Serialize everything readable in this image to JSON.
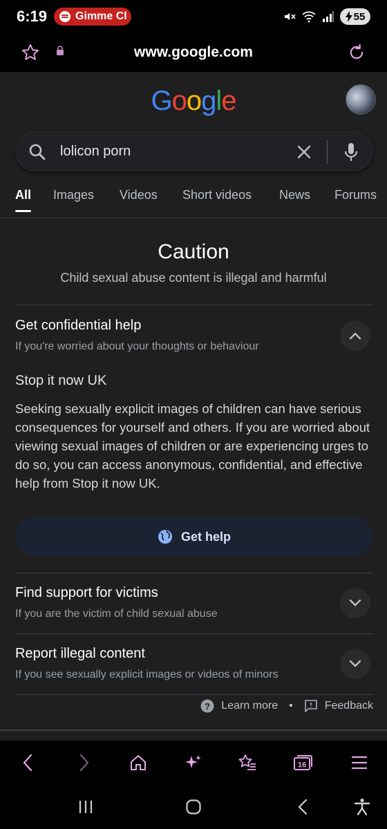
{
  "status": {
    "time": "6:19",
    "media_label": "Gimme Cl",
    "battery": "55",
    "colors": {
      "media_pill": "#c5221f"
    }
  },
  "browser": {
    "url": "www.google.com",
    "tab_count": "16"
  },
  "search": {
    "query": "lolicon porn"
  },
  "tabs": [
    "All",
    "Images",
    "Videos",
    "Short videos",
    "News",
    "Forums"
  ],
  "caution": {
    "title": "Caution",
    "subtitle": "Child sexual abuse content is illegal and harmful"
  },
  "sections": {
    "help": {
      "title": "Get confidential help",
      "subtitle": "If you're worried about your thoughts or behaviour",
      "org": "Stop it now UK",
      "body": "Seeking sexually explicit images of children can have serious consequences for yourself and others. If you are worried about viewing sexual images of children or are experiencing urges to do so, you can access anonymous, confidential, and effective help from Stop it now UK.",
      "button": "Get help"
    },
    "victims": {
      "title": "Find support for victims",
      "subtitle": "If you are the victim of child sexual abuse"
    },
    "report": {
      "title": "Report illegal content",
      "subtitle": "If you see sexually explicit images or videos of minors"
    }
  },
  "footer": {
    "learn_more": "Learn more",
    "separator": "•",
    "feedback": "Feedback"
  },
  "icons": {
    "accent": "#e6a6e6",
    "google_blue": "#4285f4",
    "google_red": "#ea4335",
    "google_yellow": "#fbbc05",
    "google_green": "#34a853"
  }
}
